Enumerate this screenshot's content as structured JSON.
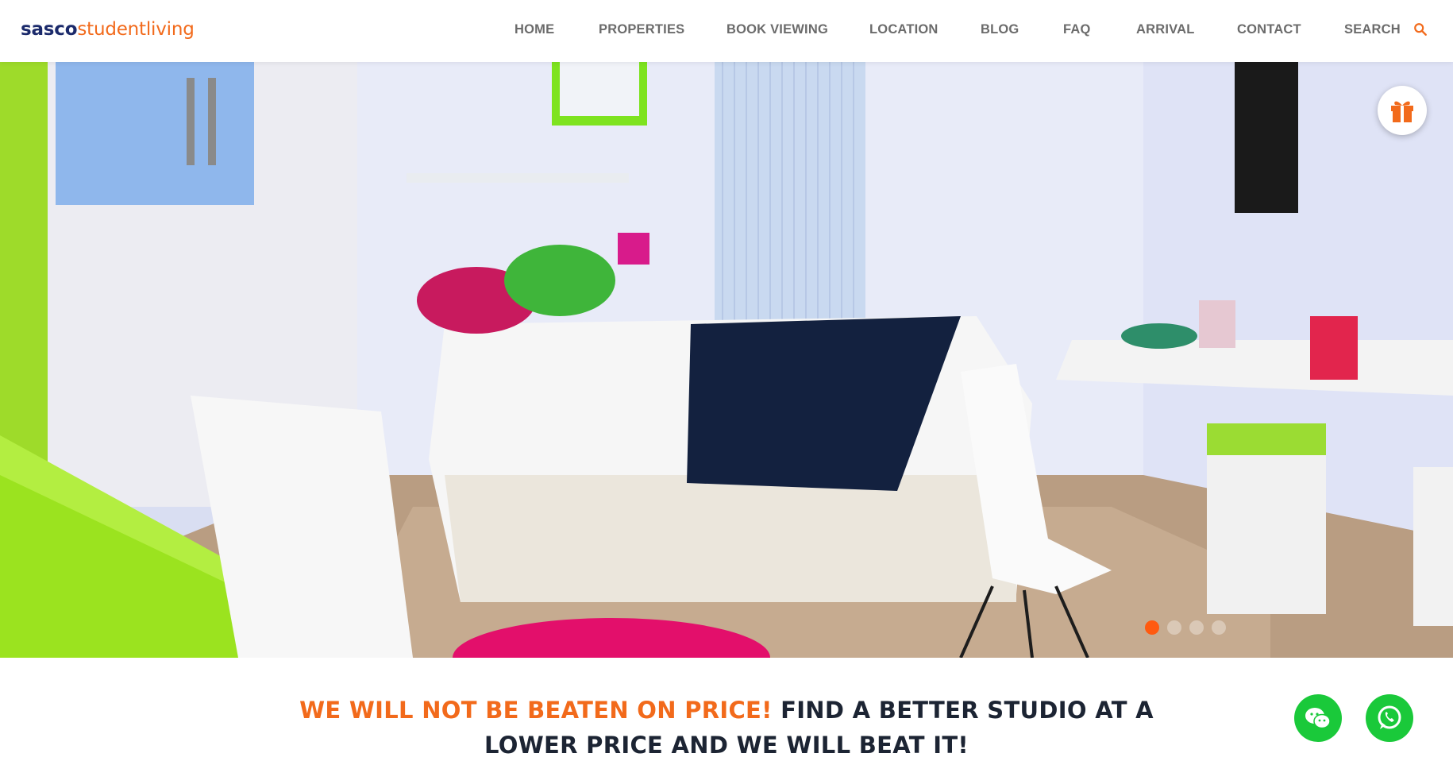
{
  "header": {
    "logo": {
      "part1": "sasco",
      "part2": "studentliving"
    },
    "nav": [
      "HOME",
      "PROPERTIES",
      "BOOK VIEWING",
      "LOCATION",
      "BLOG",
      "FAQ",
      "ARRIVAL",
      "CONTACT",
      "SEARCH"
    ]
  },
  "hero": {
    "slides_count": 4,
    "active_slide": 1
  },
  "promo": {
    "highlight": "WE WILL NOT BE BEATEN ON PRICE!",
    "line1_rest": "FIND A BETTER STUDIO AT A",
    "line2": "LOWER PRICE AND WE WILL BEAT IT!"
  },
  "colors": {
    "brand_orange": "#f26a1b",
    "brand_navy": "#1b2a6b",
    "chat_green": "#1ac93a",
    "slider_active": "#ff5a10"
  },
  "icons": [
    "search-icon",
    "gift-icon",
    "wechat-icon",
    "whatsapp-icon"
  ]
}
